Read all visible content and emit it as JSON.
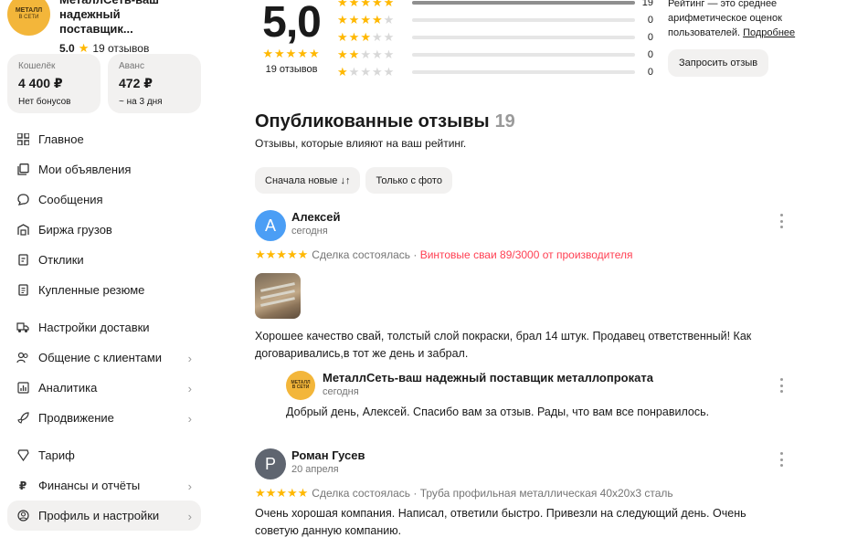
{
  "shop": {
    "logo_text_top": "МЕТАЛЛ",
    "logo_text_bottom": "В СЕТИ",
    "name": "МеталлСеть-ваш надежный поставщик...",
    "rating": "5.0",
    "reviews_count": "19 отзывов"
  },
  "wallets": [
    {
      "label": "Кошелёк",
      "value": "4 400 ₽",
      "sub": "Нет бонусов"
    },
    {
      "label": "Аванс",
      "value": "472 ₽",
      "sub": "~ на 3 дня"
    }
  ],
  "nav": [
    {
      "label": "Главное",
      "icon": "grid-icon"
    },
    {
      "label": "Мои объявления",
      "icon": "copy-icon"
    },
    {
      "label": "Сообщения",
      "icon": "chat-icon"
    },
    {
      "label": "Биржа грузов",
      "icon": "truck-icon"
    },
    {
      "label": "Отклики",
      "icon": "response-icon"
    },
    {
      "label": "Купленные резюме",
      "icon": "resume-icon"
    },
    {
      "label": "Настройки доставки",
      "icon": "delivery-icon"
    },
    {
      "label": "Общение с клиентами",
      "icon": "people-icon"
    },
    {
      "label": "Аналитика",
      "icon": "chart-icon"
    },
    {
      "label": "Продвижение",
      "icon": "rocket-icon"
    },
    {
      "label": "Тариф",
      "icon": "tariff-icon"
    },
    {
      "label": "Финансы и отчёты",
      "icon": "ruble-icon"
    },
    {
      "label": "Профиль и настройки",
      "icon": "profile-icon"
    }
  ],
  "rating_summary": {
    "score": "5,0",
    "count_label": "19 отзывов",
    "distribution": [
      {
        "stars": 5,
        "count": "19",
        "fraction": 1.0
      },
      {
        "stars": 4,
        "count": "0",
        "fraction": 0
      },
      {
        "stars": 3,
        "count": "0",
        "fraction": 0
      },
      {
        "stars": 2,
        "count": "0",
        "fraction": 0
      },
      {
        "stars": 1,
        "count": "0",
        "fraction": 0
      }
    ],
    "note": "Рейтинг — это среднее арифметическое оценок пользователей.",
    "note_link": "Подробнее",
    "request_button": "Запросить отзыв"
  },
  "published": {
    "title": "Опубликованные отзывы",
    "count": "19",
    "subtitle": "Отзывы, которые влияют на ваш рейтинг.",
    "sort_chip": "Сначала новые ↓↑",
    "photo_chip": "Только с фото"
  },
  "reviews": [
    {
      "initial": "А",
      "name": "Алексей",
      "date": "сегодня",
      "stars": "★★★★★",
      "deal": "Сделка состоялась · ",
      "product": "Винтовые сваи 89/3000 от производителя",
      "text": "Хорошее качество свай, толстый слой покраски, брал 14 штук. Продавец ответственный! Как договаривались,в тот же день и забрал.",
      "avatar_color": "#4b9ef5"
    },
    {
      "initial": "Р",
      "name": "Роман Гусев",
      "date": "20 апреля",
      "stars": "★★★★★",
      "deal": "Сделка состоялась · ",
      "product": "Труба профильная металлическая 40х20х3 сталь",
      "text": "Очень хорошая компания. Написал, ответили быстро. Привезли на следующий день. Очень советую данную компанию.",
      "avatar_color": "#5f6570"
    }
  ],
  "reply": {
    "name": "МеталлСеть-ваш надежный поставщик металлопроката",
    "date": "сегодня",
    "text": "Добрый день, Алексей. Спасибо вам за отзыв. Рады, что вам все понравилось."
  }
}
